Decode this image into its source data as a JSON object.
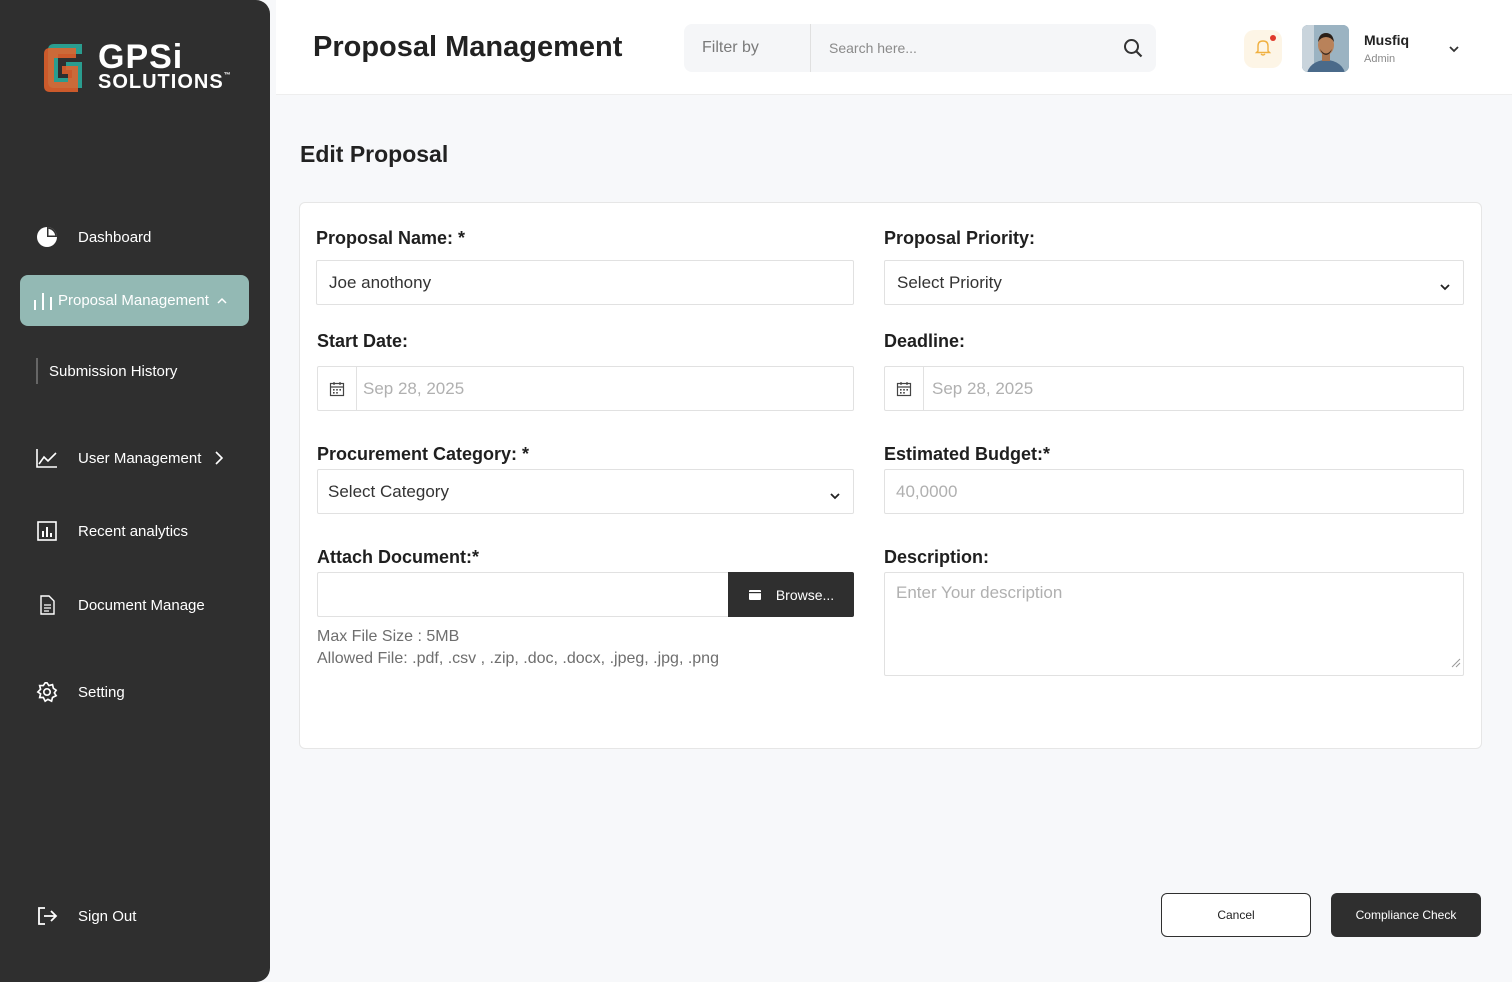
{
  "brand": {
    "name_line1": "GPSi",
    "name_line2": "SOLUTIONS",
    "trademark": "™"
  },
  "colors": {
    "sidebar_bg": "#2f2f2f",
    "active_nav": "#93b9b4",
    "logo_orange": "#e8622a",
    "logo_teal": "#2a9d8f",
    "notification_dot": "#e0392b"
  },
  "sidebar": {
    "items": [
      {
        "label": "Dashboard",
        "icon": "pie-chart-icon"
      },
      {
        "label": "Proposal Management",
        "icon": "bar-chart-icon",
        "active": true,
        "expanded": true
      },
      {
        "label": "Submission History",
        "sub": true
      },
      {
        "label": "User Management",
        "icon": "line-chart-icon"
      },
      {
        "label": "Recent analytics",
        "icon": "analytics-icon"
      },
      {
        "label": "Document Manage",
        "icon": "document-icon"
      },
      {
        "label": "Setting",
        "icon": "gear-icon"
      }
    ],
    "sign_out": "Sign Out"
  },
  "header": {
    "title": "Proposal Management",
    "filter_label": "Filter by",
    "search_placeholder": "Search here...",
    "user": {
      "name": "Musfiq",
      "role": "Admin"
    }
  },
  "form": {
    "section_title": "Edit Proposal",
    "proposal_name": {
      "label": "Proposal Name: *",
      "value": "Joe anothony"
    },
    "priority": {
      "label": "Proposal Priority:",
      "value": "Select Priority"
    },
    "start_date": {
      "label": "Start Date:",
      "placeholder": "Sep 28, 2025"
    },
    "deadline": {
      "label": "Deadline:",
      "placeholder": "Sep 28, 2025"
    },
    "category": {
      "label": "Procurement Category: *",
      "value": "Select Category"
    },
    "budget": {
      "label": "Estimated Budget:*",
      "placeholder": "40,0000"
    },
    "attach": {
      "label": "Attach Document:*",
      "button": "Browse...",
      "max_size": "Max File Size : 5MB",
      "allowed": "Allowed File: .pdf, .csv , .zip, .doc, .docx, .jpeg, .jpg, .png"
    },
    "description": {
      "label": "Description:",
      "placeholder": "Enter Your description"
    }
  },
  "actions": {
    "cancel": "Cancel",
    "compliance": "Compliance Check"
  }
}
